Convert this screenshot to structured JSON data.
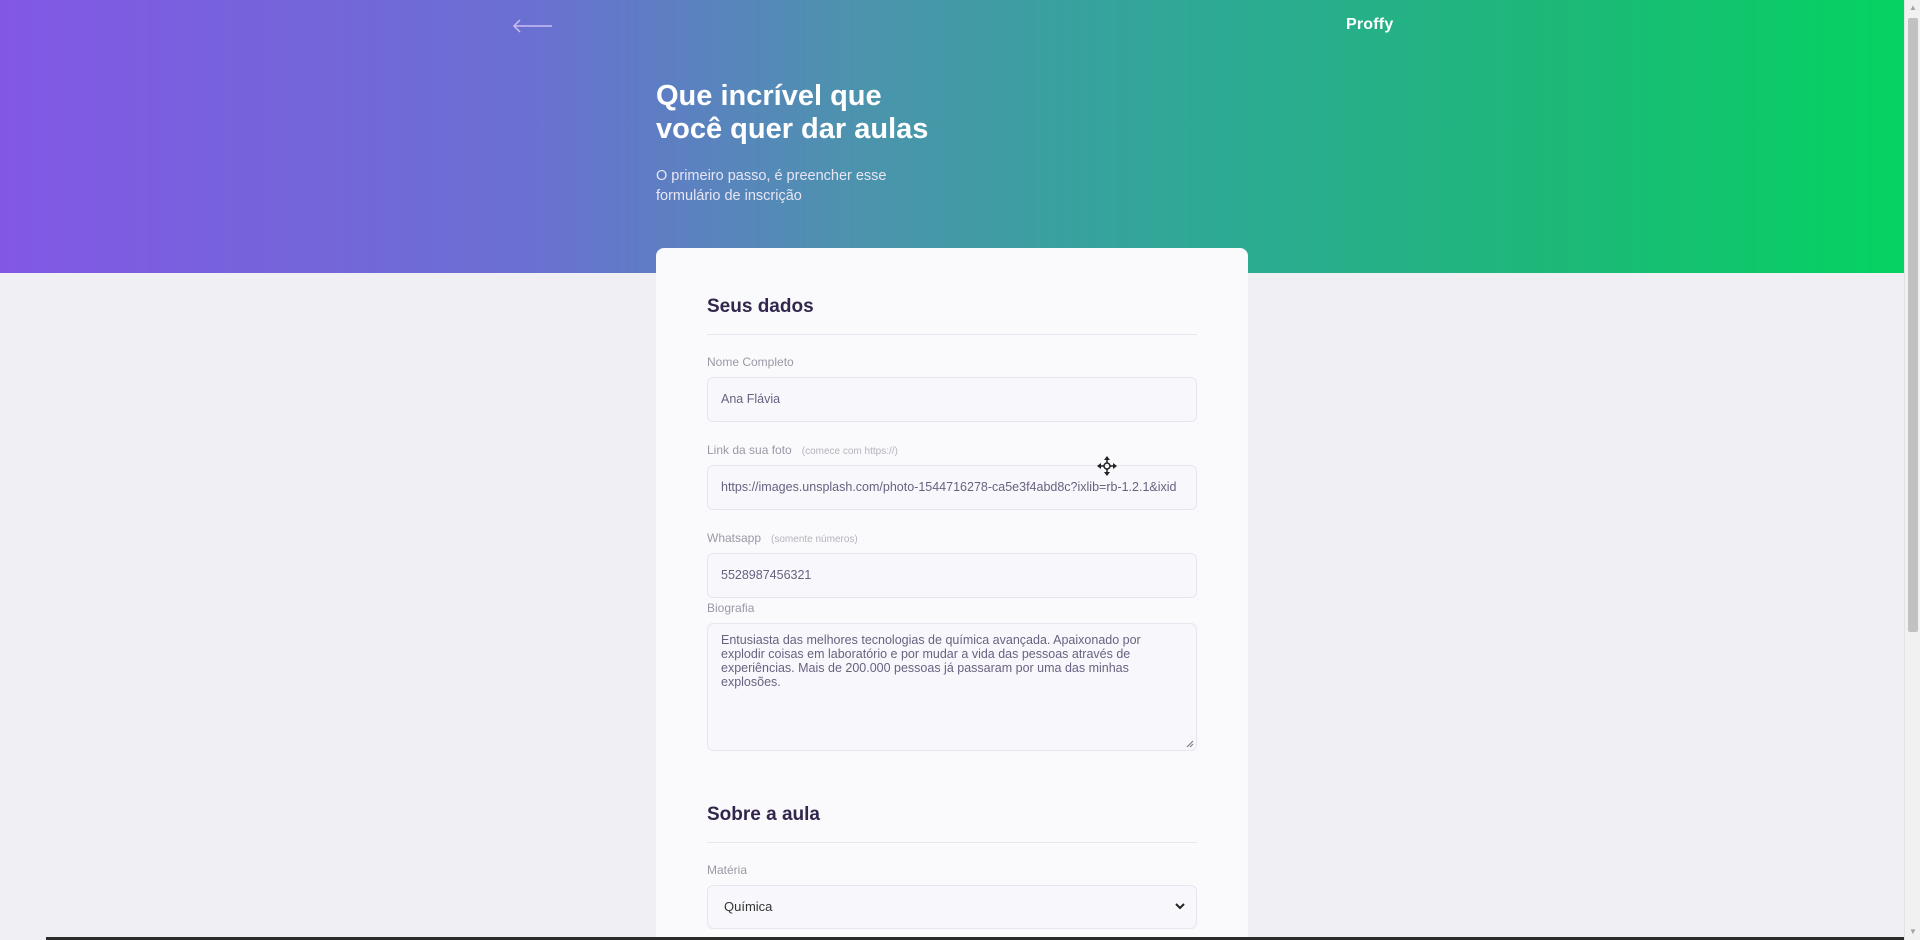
{
  "header": {
    "logo": "Proffy",
    "back_icon": "arrow-left-icon",
    "title_line1": "Que incrível que",
    "title_line2": "você quer dar aulas",
    "subtitle_line1": "O primeiro passo, é preencher esse",
    "subtitle_line2": "formulário de inscrição"
  },
  "form": {
    "section1_title": "Seus dados",
    "name": {
      "label": "Nome Completo",
      "value": "Ana Flávia"
    },
    "avatar": {
      "label": "Link da sua foto",
      "hint": "(comece com https://)",
      "value": "https://images.unsplash.com/photo-1544716278-ca5e3f4abd8c?ixlib=rb-1.2.1&ixid"
    },
    "whatsapp": {
      "label": "Whatsapp",
      "hint": "(somente números)",
      "value": "5528987456321"
    },
    "bio": {
      "label": "Biografia",
      "line1": "Entusiasta das melhores tecnologias de química avançada. Apaixonado por",
      "line2": "explodir coisas em laboratório e por mudar a vida das pessoas através de",
      "line3": "experiências. Mais de 200.000 pessoas já passaram por uma das minhas",
      "line4": "explosões."
    },
    "section2_title": "Sobre a aula",
    "subject": {
      "label": "Matéria",
      "value": "Química",
      "icon": "chevron-down-icon"
    }
  },
  "colors": {
    "primary": "#8257e5",
    "secondary": "#04d361",
    "card": "#fafafc",
    "title_text": "#32264d"
  }
}
